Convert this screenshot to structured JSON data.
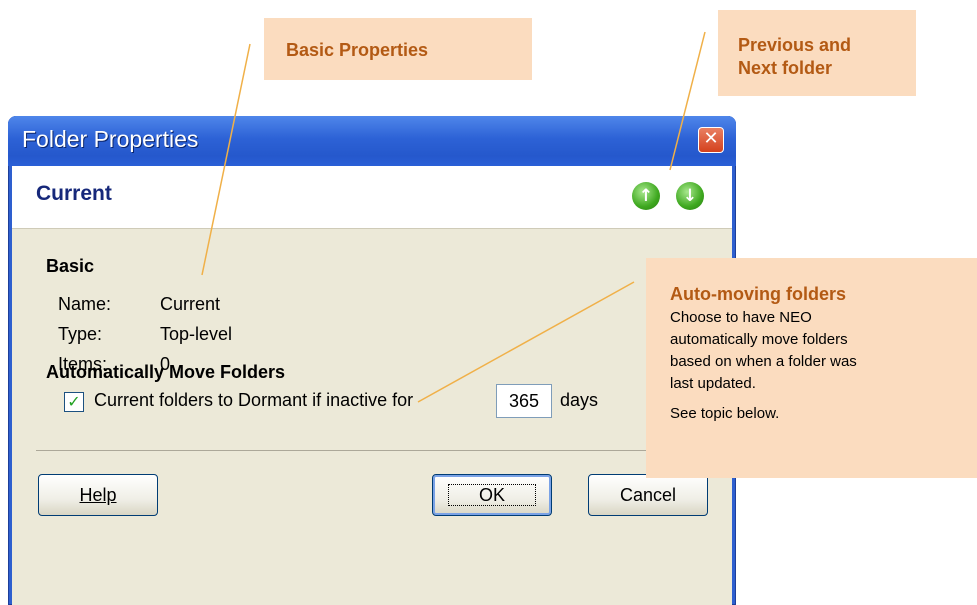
{
  "window": {
    "title": "Folder Properties",
    "close_icon": "close-icon"
  },
  "header": {
    "title": "Current",
    "prev_icon": "up-arrow-icon",
    "next_icon": "down-arrow-icon"
  },
  "basic": {
    "heading": "Basic",
    "name_label": "Name:",
    "name_value": "Current",
    "type_label": "Type:",
    "type_value": "Top-level",
    "items_label": "Items:",
    "items_value": "0"
  },
  "auto_move": {
    "heading": "Automatically Move Folders",
    "checked": true,
    "checkbox_label": "Current folders to Dormant if inactive for",
    "days_value": "365",
    "days_unit": "days"
  },
  "buttons": {
    "help": "Help",
    "ok": "OK",
    "cancel": "Cancel"
  },
  "callouts": {
    "basic_props": "Basic Properties",
    "prev_next_line1": "Previous and",
    "prev_next_line2": "Next folder",
    "auto_heading": "Auto-moving folders",
    "auto_body": [
      "Choose to have NEO",
      "automatically move folders",
      "based on when a folder was",
      "last updated."
    ],
    "auto_footer": "See topic below."
  },
  "colors": {
    "callout_bg": "#fbdcbf",
    "callout_heading": "#b35a14",
    "title_bar": "#2d62d6",
    "nav_green": "#3ea81f"
  }
}
